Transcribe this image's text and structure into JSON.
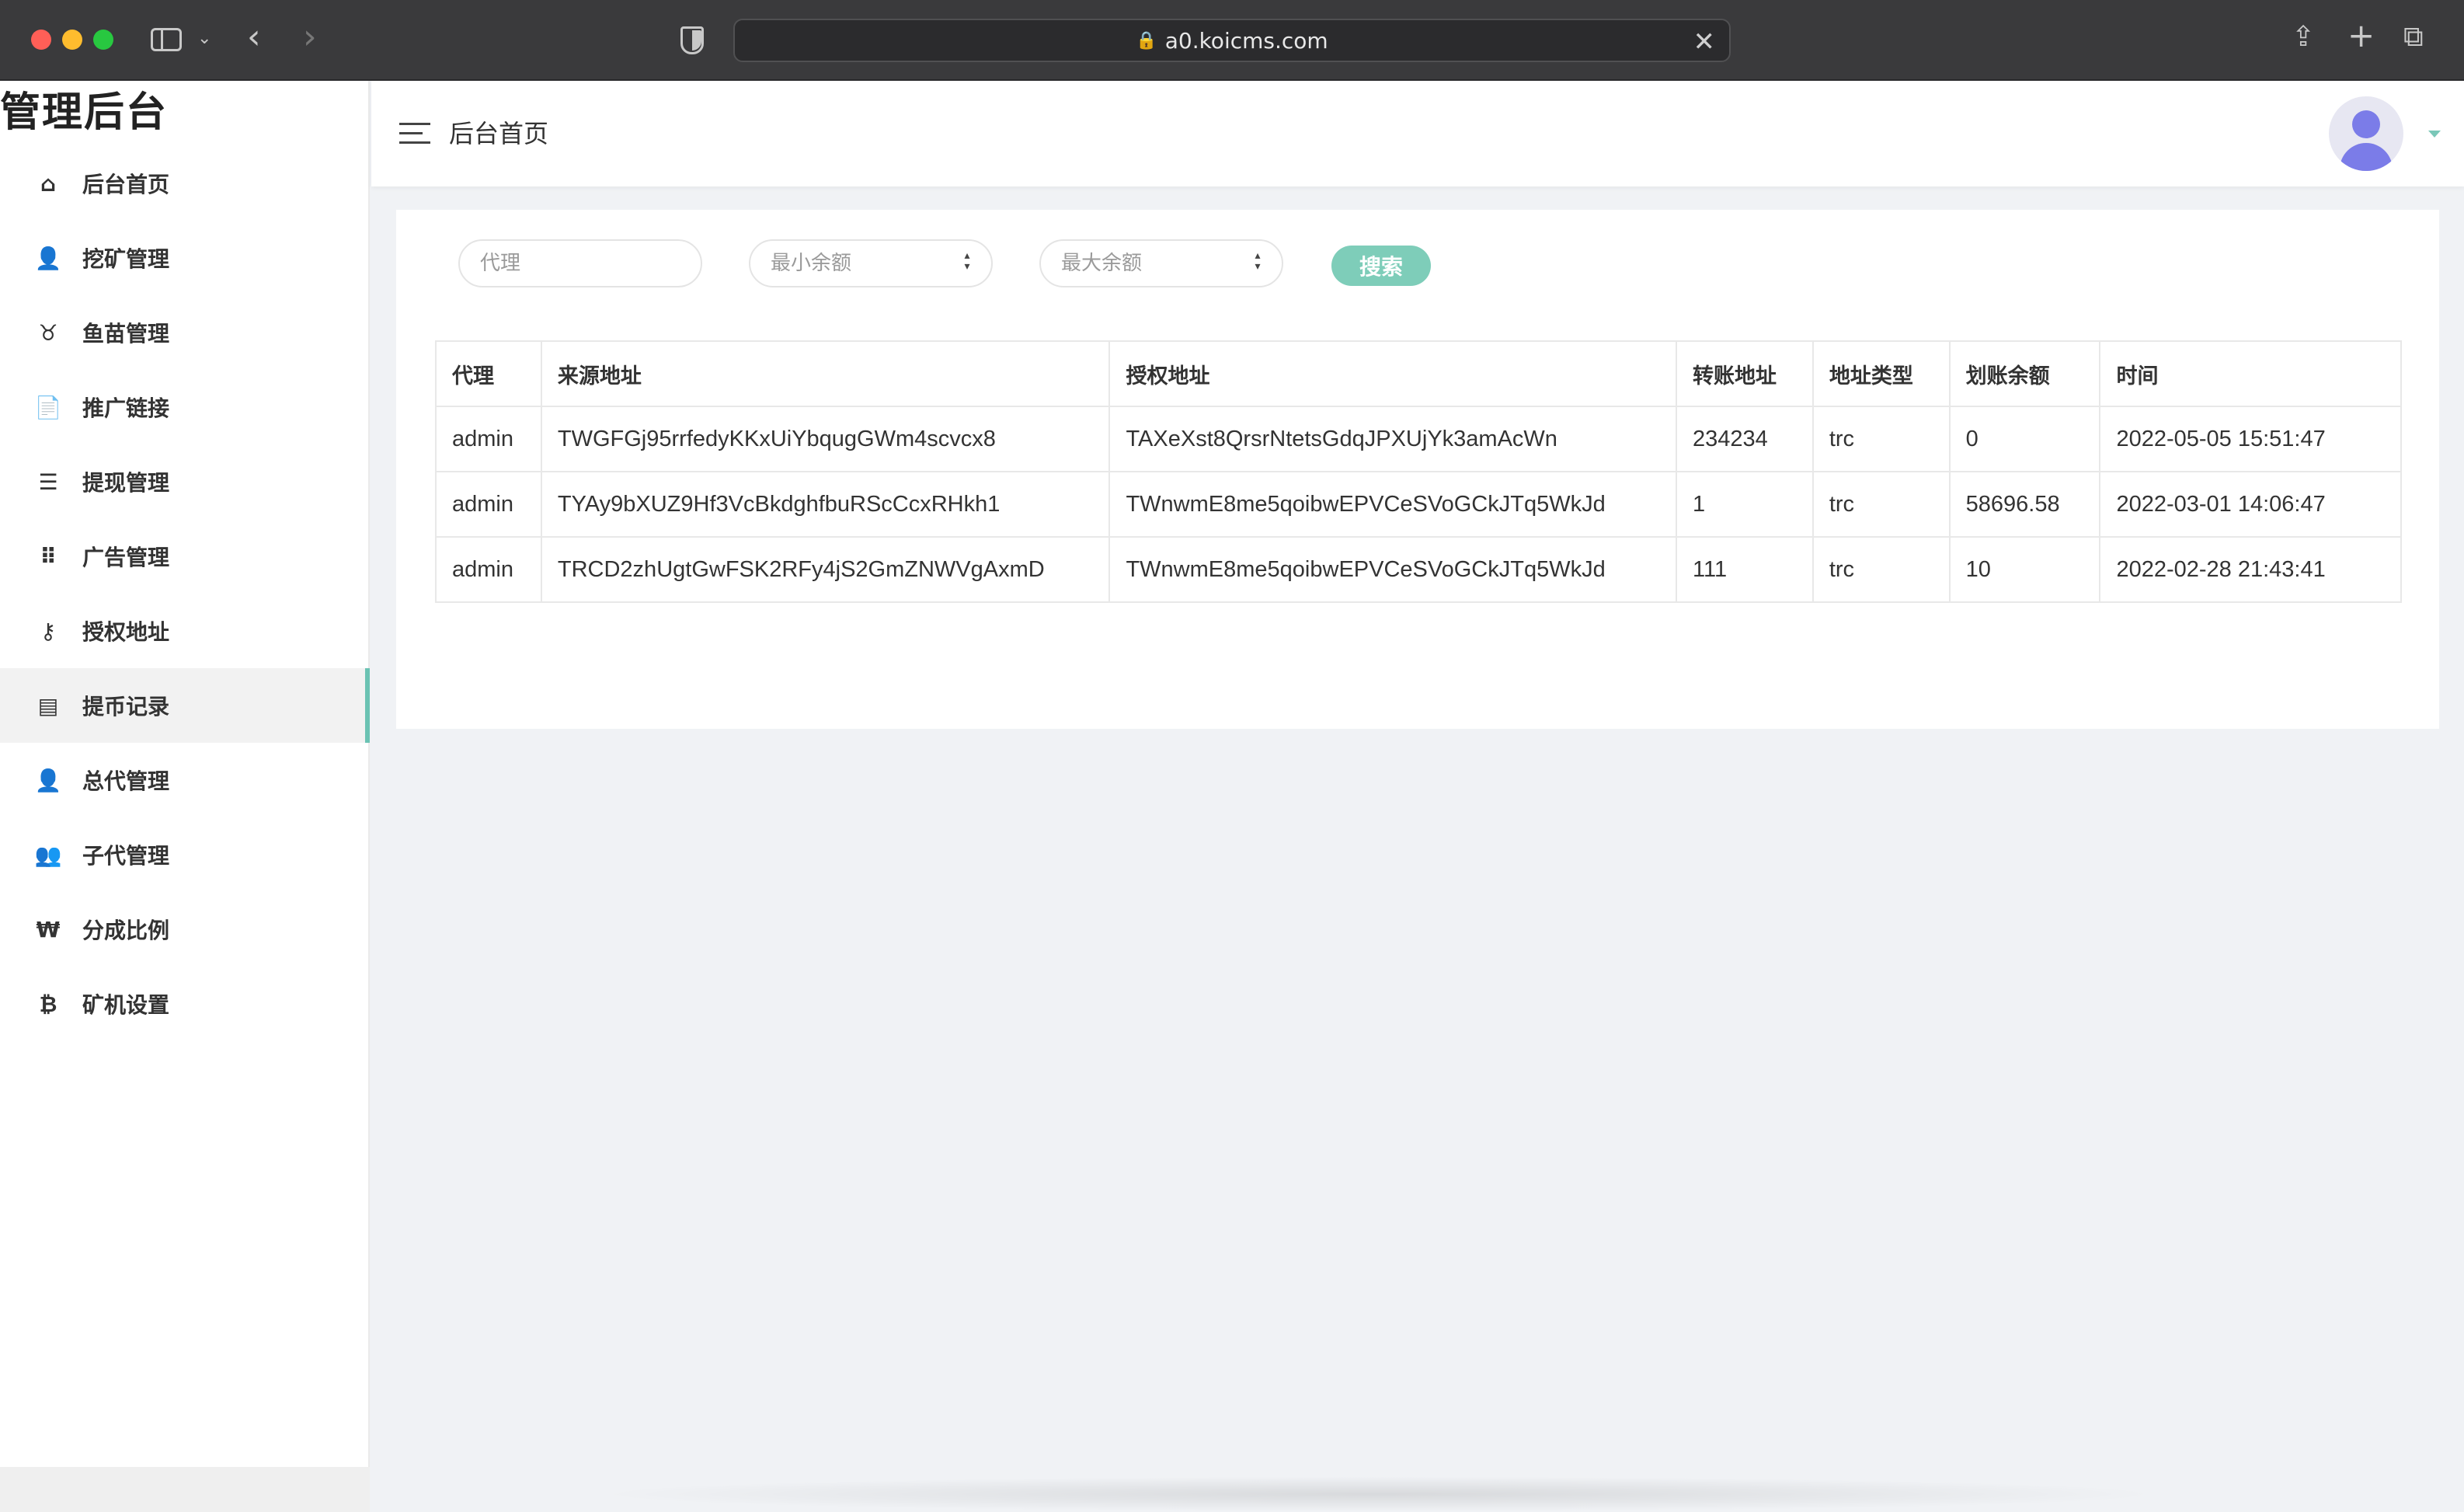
{
  "browser": {
    "url": "a0.koicms.com"
  },
  "sidebar": {
    "brand": "管理后台",
    "items": [
      {
        "label": "后台首页",
        "icon": "⌂"
      },
      {
        "label": "挖矿管理",
        "icon": "👤"
      },
      {
        "label": "鱼苗管理",
        "icon": "♉"
      },
      {
        "label": "推广链接",
        "icon": "📄"
      },
      {
        "label": "提现管理",
        "icon": "☰"
      },
      {
        "label": "广告管理",
        "icon": "⠿"
      },
      {
        "label": "授权地址",
        "icon": "⚷"
      },
      {
        "label": "提币记录",
        "icon": "▤"
      },
      {
        "label": "总代管理",
        "icon": "👤"
      },
      {
        "label": "子代管理",
        "icon": "👥"
      },
      {
        "label": "分成比例",
        "icon": "₩"
      },
      {
        "label": "矿机设置",
        "icon": "₿"
      }
    ],
    "active_index": 7
  },
  "header": {
    "title": "后台首页"
  },
  "filters": {
    "agent_placeholder": "代理",
    "min_placeholder": "最小余额",
    "max_placeholder": "最大余额",
    "search_label": "搜索"
  },
  "table": {
    "headers": [
      "代理",
      "来源地址",
      "授权地址",
      "转账地址",
      "地址类型",
      "划账余额",
      "时间"
    ],
    "rows": [
      [
        "admin",
        "TWGFGj95rrfedyKKxUiYbqugGWm4scvcx8",
        "TAXeXst8QrsrNtetsGdqJPXUjYk3amAcWn",
        "234234",
        "trc",
        "0",
        "2022-05-05 15:51:47"
      ],
      [
        "admin",
        "TYAy9bXUZ9Hf3VcBkdghfbuRScCcxRHkh1",
        "TWnwmE8me5qoibwEPVCeSVoGCkJTq5WkJd",
        "1",
        "trc",
        "58696.58",
        "2022-03-01 14:06:47"
      ],
      [
        "admin",
        "TRCD2zhUgtGwFSK2RFy4jS2GmZNWVgAxmD",
        "TWnwmE8me5qoibwEPVCeSVoGCkJTq5WkJd",
        "111",
        "trc",
        "10",
        "2022-02-28 21:43:41"
      ]
    ]
  },
  "colors": {
    "accent": "#7ecdb9",
    "active_bar": "#6bc3b3",
    "avatar": "#7b7ce8"
  }
}
